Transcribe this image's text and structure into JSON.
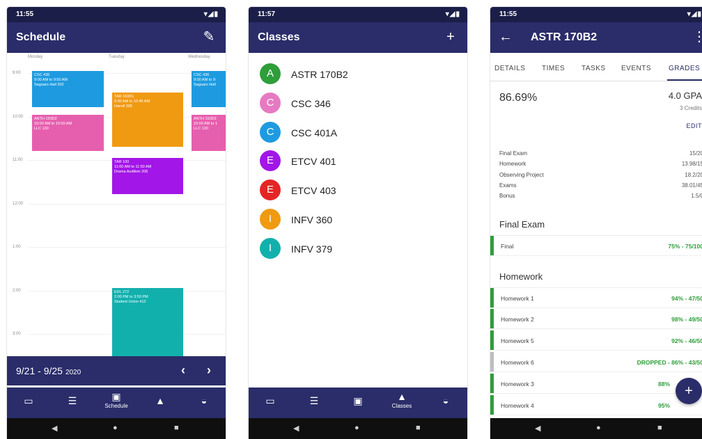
{
  "phones": {
    "schedule": {
      "status_time": "11:55",
      "title": "Schedule",
      "days": [
        "Monday",
        "Tuesday",
        "Wednesday"
      ],
      "times": [
        "9:00",
        "10:00",
        "11:00",
        "12:00",
        "1:00",
        "2:00",
        "3:00"
      ],
      "events": [
        {
          "lines": [
            "CSC 436",
            "9:00 AM to 9:50 AM",
            "Saguaro Hall 202"
          ],
          "color": "#1e9be0"
        },
        {
          "lines": [
            "ANTH 150D2",
            "10:00 AM to 10:50 AM",
            "LLC 130"
          ],
          "color": "#e65fae"
        },
        {
          "lines": [
            "TAR 160D1",
            "9:30 AM to 10:45 AM",
            "Harvill 305"
          ],
          "color": "#f09a12"
        },
        {
          "lines": [
            "TAR 100",
            "11:00 AM to 11:50 AM",
            "Drama Audition 206"
          ],
          "color": "#a216e8"
        },
        {
          "lines": [
            "EDL 272",
            "2:00 PM to 3:50 PM",
            "Student Union 412"
          ],
          "color": "#12b0ad"
        },
        {
          "lines": [
            "CSC 436",
            "9:00 AM to 9:",
            "Saguaro Hall"
          ],
          "color": "#1e9be0"
        },
        {
          "lines": [
            "ANTH 150D2",
            "10:00 AM to 1",
            "LLC 130"
          ],
          "color": "#e65fae"
        }
      ],
      "date_range": "9/21 - 9/25",
      "year": "2020",
      "nav_active_label": "Schedule"
    },
    "classes": {
      "status_time": "11:57",
      "title": "Classes",
      "items": [
        {
          "letter": "A",
          "name": "ASTR 170B2",
          "color": "#2e9e3a"
        },
        {
          "letter": "C",
          "name": "CSC 346",
          "color": "#e67ac2"
        },
        {
          "letter": "C",
          "name": "CSC 401A",
          "color": "#1e9be0"
        },
        {
          "letter": "E",
          "name": "ETCV 401",
          "color": "#a216e8"
        },
        {
          "letter": "E",
          "name": "ETCV 403",
          "color": "#e52525"
        },
        {
          "letter": "I",
          "name": "INFV 360",
          "color": "#f09a12"
        },
        {
          "letter": "I",
          "name": "INFV 379",
          "color": "#12b0ad"
        }
      ],
      "nav_active_label": "Classes"
    },
    "detail": {
      "status_time": "11:55",
      "title": "ASTR 170B2",
      "tabs": [
        "DETAILS",
        "TIMES",
        "TASKS",
        "EVENTS",
        "GRADES"
      ],
      "percent": "86.69%",
      "gpa": "4.0 GPA",
      "credits": "3 Credits",
      "edit_label": "EDIT",
      "categories": [
        {
          "name": "Final Exam",
          "value": "15/20"
        },
        {
          "name": "Homework",
          "value": "13.98/15"
        },
        {
          "name": "Observing Project",
          "value": "18.2/20"
        },
        {
          "name": "Exams",
          "value": "38.01/45"
        },
        {
          "name": "Bonus",
          "value": "1.5/0"
        }
      ],
      "section_final": "Final Exam",
      "final_row": {
        "name": "Final",
        "value": "75% - 75/100"
      },
      "section_homework": "Homework",
      "homework_rows": [
        {
          "name": "Homework 1",
          "value": "94% - 47/50",
          "status": "graded"
        },
        {
          "name": "Homework 2",
          "value": "98% - 49/50",
          "status": "graded"
        },
        {
          "name": "Homework 5",
          "value": "92% - 46/50",
          "status": "graded"
        },
        {
          "name": "Homework 6",
          "value": "DROPPED - 86% - 43/50",
          "status": "dropped"
        },
        {
          "name": "Homework 3",
          "value": "88%",
          "status": "graded"
        },
        {
          "name": "Homework 4",
          "value": "95%",
          "status": "graded"
        }
      ]
    }
  },
  "colors": {
    "primary": "#2a2d69",
    "status": "#1b1e48",
    "green": "#2e9e3a",
    "dropped": "#bdbdbd"
  }
}
